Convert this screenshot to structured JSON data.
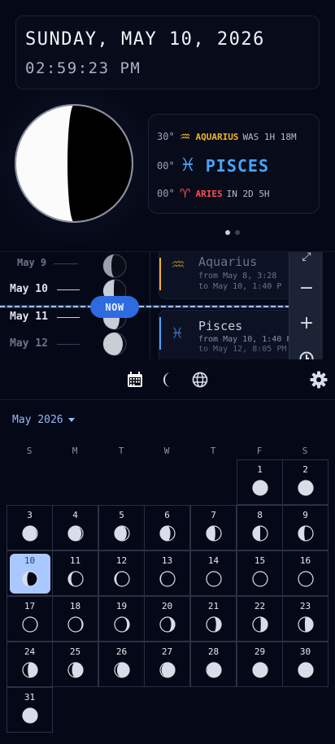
{
  "header": {
    "date": "SUNDAY, MAY 10, 2026",
    "time": "02:59:23 PM"
  },
  "zodiac_card": {
    "previous": {
      "degree": "30°",
      "glyph": "♒",
      "name": "AQUARIUS",
      "relative": "WAS 1H 18M"
    },
    "current": {
      "degree": "00°",
      "glyph": "♓",
      "name": "PISCES"
    },
    "next": {
      "degree": "00°",
      "glyph": "♈",
      "name": "ARIES",
      "relative": "IN 2D 5H"
    },
    "colors": {
      "aquarius": "#f0b429",
      "pisces": "#4aa3ff",
      "aries": "#ff4f4f"
    }
  },
  "pager": {
    "pages": 2,
    "active": 1
  },
  "timeline": {
    "days": [
      {
        "label": "May 9"
      },
      {
        "label": "May 10"
      },
      {
        "label": "May 11"
      },
      {
        "label": "May 12"
      }
    ],
    "now_label": "NOW",
    "segments": [
      {
        "glyph": "♒",
        "name": "Aquarius",
        "from": "from May 8, 3:28",
        "to": "to May 10, 1:40 P"
      },
      {
        "glyph": "♓",
        "name": "Pisces",
        "from": "from May 10, 1:40 P",
        "to": "to May 12, 8:05 PM"
      }
    ],
    "zoom": {
      "fit": "⤢",
      "out": "−",
      "in": "+"
    }
  },
  "nav": {
    "icons": [
      "calendar-icon",
      "moon-icon",
      "globe-icon",
      "gear-icon"
    ],
    "active": "calendar-icon"
  },
  "calendar": {
    "month_label": "May 2026",
    "weekdays": [
      "S",
      "M",
      "T",
      "W",
      "T",
      "F",
      "S"
    ],
    "first_weekday": 5,
    "selected": 10,
    "days": [
      {
        "d": "1",
        "ill": 1.0,
        "wax": false
      },
      {
        "d": "2",
        "ill": 0.98,
        "wax": false
      },
      {
        "d": "3",
        "ill": 0.95,
        "wax": false
      },
      {
        "d": "4",
        "ill": 0.9,
        "wax": false
      },
      {
        "d": "5",
        "ill": 0.82,
        "wax": false
      },
      {
        "d": "6",
        "ill": 0.7,
        "wax": false
      },
      {
        "d": "7",
        "ill": 0.6,
        "wax": false
      },
      {
        "d": "8",
        "ill": 0.5,
        "wax": false
      },
      {
        "d": "9",
        "ill": 0.4,
        "wax": false
      },
      {
        "d": "10",
        "ill": 0.3,
        "wax": false
      },
      {
        "d": "11",
        "ill": 0.2,
        "wax": false
      },
      {
        "d": "12",
        "ill": 0.12,
        "wax": false
      },
      {
        "d": "13",
        "ill": 0.06,
        "wax": false
      },
      {
        "d": "14",
        "ill": 0.02,
        "wax": false
      },
      {
        "d": "15",
        "ill": 0.0,
        "wax": true
      },
      {
        "d": "16",
        "ill": 0.01,
        "wax": true
      },
      {
        "d": "17",
        "ill": 0.04,
        "wax": true
      },
      {
        "d": "18",
        "ill": 0.09,
        "wax": true
      },
      {
        "d": "19",
        "ill": 0.16,
        "wax": true
      },
      {
        "d": "20",
        "ill": 0.25,
        "wax": true
      },
      {
        "d": "21",
        "ill": 0.35,
        "wax": true
      },
      {
        "d": "22",
        "ill": 0.46,
        "wax": true
      },
      {
        "d": "23",
        "ill": 0.56,
        "wax": true
      },
      {
        "d": "24",
        "ill": 0.66,
        "wax": true
      },
      {
        "d": "25",
        "ill": 0.75,
        "wax": true
      },
      {
        "d": "26",
        "ill": 0.84,
        "wax": true
      },
      {
        "d": "27",
        "ill": 0.91,
        "wax": true
      },
      {
        "d": "28",
        "ill": 0.96,
        "wax": true
      },
      {
        "d": "29",
        "ill": 0.99,
        "wax": true
      },
      {
        "d": "30",
        "ill": 1.0,
        "wax": true
      },
      {
        "d": "31",
        "ill": 1.0,
        "wax": false
      }
    ]
  }
}
